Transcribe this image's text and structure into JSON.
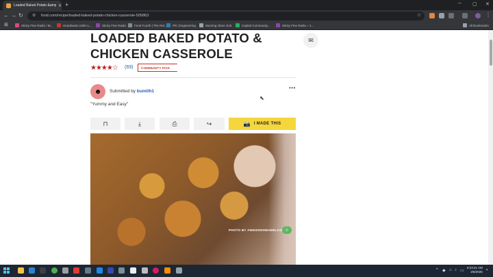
{
  "browser": {
    "tab_title": "Loaded Baked Potato &amp; Chic...",
    "tab_close": "✕",
    "new_tab": "+",
    "url": "food.com/recipe/loaded-baked-potato-chicken-casserole-505863",
    "bookmarks": [
      "Sticky Fine Radio / IE...",
      "Heartbeats Unlim L...",
      "Sticky Fine Radio",
      "Feral Fourth | The Ret...",
      "PR | Engineering",
      "Morning share club",
      "Capital Community...",
      "Sticky Fine Radio ~ 1..."
    ],
    "all_bookmarks": "All Bookmarks",
    "colors": {
      "tabstrip": "#1f2022",
      "toolbar": "#35363a"
    }
  },
  "recipe": {
    "title": "LOADED BAKED POTATO & CHICKEN CASSEROLE",
    "stars": "★★★★☆",
    "rating_count": "(69)",
    "badge": "COMMUNITY PICK",
    "submitted_prefix": "Submitted by",
    "submitted_user": "bumith1",
    "more": "•••",
    "quote": "\"Yummy and Easy\"",
    "actions": {
      "bookmark_icon": "bookmark-icon",
      "download_icon": "download-icon",
      "print_icon": "print-icon",
      "share_icon": "share-icon",
      "made_label": "I MADE THIS"
    },
    "photo_credit": "PHOTO BY ANNISSHOMAEBLOG",
    "accent_color": "#f6d63d",
    "star_color": "#b2241f"
  },
  "taskbar": {
    "time": "8:23:21 AM",
    "date": "2/5/2025"
  }
}
